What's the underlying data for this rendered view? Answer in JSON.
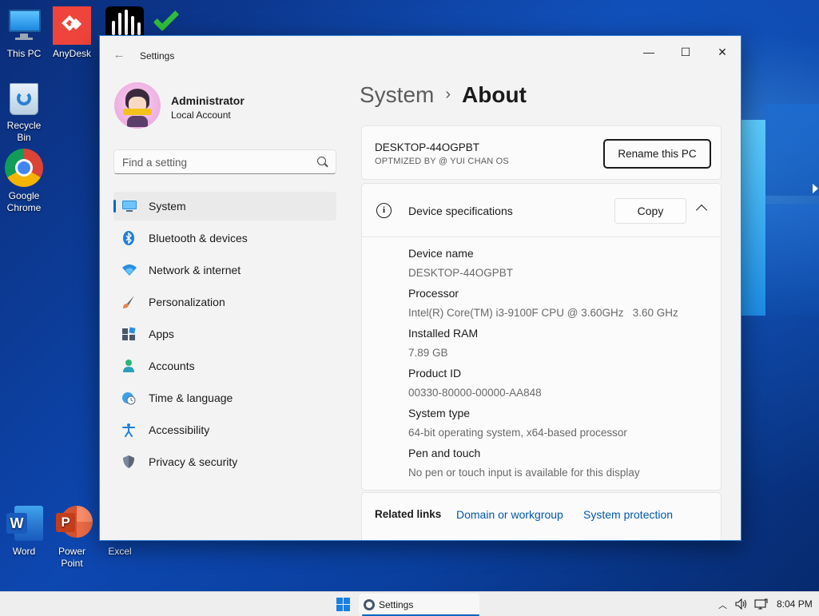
{
  "desktop": {
    "icons": [
      {
        "label": "This PC"
      },
      {
        "label": "AnyDesk"
      },
      {
        "label": "Recycle Bin"
      },
      {
        "label": "Google Chrome"
      },
      {
        "label": "Word"
      },
      {
        "label": "Power Point"
      },
      {
        "label": "Excel"
      }
    ]
  },
  "window": {
    "app_title": "Settings",
    "controls": {
      "minimize": "—",
      "maximize": "☐",
      "close": "✕"
    }
  },
  "profile": {
    "name": "Administrator",
    "account_type": "Local Account"
  },
  "search": {
    "placeholder": "Find a setting"
  },
  "nav": {
    "items": [
      {
        "label": "System",
        "icon": "monitor-icon",
        "active": true
      },
      {
        "label": "Bluetooth & devices",
        "icon": "bluetooth-icon"
      },
      {
        "label": "Network & internet",
        "icon": "wifi-icon"
      },
      {
        "label": "Personalization",
        "icon": "brush-icon"
      },
      {
        "label": "Apps",
        "icon": "apps-icon"
      },
      {
        "label": "Accounts",
        "icon": "person-icon"
      },
      {
        "label": "Time & language",
        "icon": "globe-clock-icon"
      },
      {
        "label": "Accessibility",
        "icon": "accessibility-icon"
      },
      {
        "label": "Privacy & security",
        "icon": "shield-icon"
      }
    ]
  },
  "breadcrumb": {
    "parent": "System",
    "separator": "›",
    "current": "About"
  },
  "pc_card": {
    "name": "DESKTOP-44OGPBT",
    "subtitle": "OPTMIZED BY @ YUI CHAN OS",
    "rename_label": "Rename this PC"
  },
  "specs": {
    "title": "Device specifications",
    "copy_label": "Copy",
    "rows": [
      {
        "label": "Device name",
        "value": "DESKTOP-44OGPBT"
      },
      {
        "label": "Processor",
        "value": "Intel(R) Core(TM) i3-9100F CPU @ 3.60GHz   3.60 GHz"
      },
      {
        "label": "Installed RAM",
        "value": "7.89 GB"
      },
      {
        "label": "Product ID",
        "value": "00330-80000-00000-AA848"
      },
      {
        "label": "System type",
        "value": "64-bit operating system, x64-based processor"
      },
      {
        "label": "Pen and touch",
        "value": "No pen or touch input is available for this display"
      }
    ]
  },
  "related": {
    "title": "Related links",
    "links": [
      "Domain or workgroup",
      "System protection"
    ]
  },
  "taskbar": {
    "active_app": "Settings",
    "clock": "8:04 PM"
  },
  "colors": {
    "accent": "#0067c0",
    "link": "#0058a8",
    "window_bg": "#f3f3f3"
  }
}
